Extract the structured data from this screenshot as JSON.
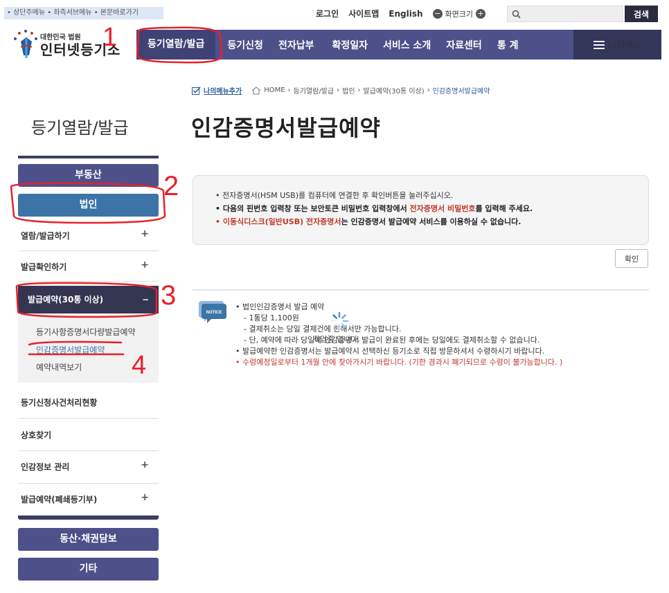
{
  "topbar": {
    "skip_links": "• 상단주메뉴 • 좌측서브메뉴 • 본문바로가기",
    "login": "로그인",
    "sitemap": "사이트맵",
    "english": "English",
    "zoom_label": "화면크기",
    "search_button": "검색"
  },
  "logo": {
    "small": "대한민국 법원",
    "big": "인터넷등기소"
  },
  "nav": {
    "items": [
      "등기열람/발급",
      "등기신청",
      "전자납부",
      "확정일자",
      "서비스 소개",
      "자료센터",
      "통 계"
    ],
    "mymenu": "나의메뉴"
  },
  "breadcrumb": {
    "add": "나의메뉴추가",
    "home": "HOME",
    "path": [
      "등기열람/발급",
      "법인",
      "발급예약(30통 이상)"
    ],
    "current": "인감증명서발급예약"
  },
  "side": {
    "title": "등기열람/발급",
    "cat_realty": "부동산",
    "cat_corp": "법인",
    "item_view": "열람/발급하기",
    "item_check": "발급확인하기",
    "item_reserve": "발급예약(30통 이상)",
    "sub_1": "등기사항증명서다량발급예약",
    "sub_2": "인감증명서발급예약",
    "sub_3": "예약내역보기",
    "item_status": "등기신청사건처리현황",
    "item_find": "상호찾기",
    "item_seal": "인감정보 관리",
    "item_closed": "발급예약(폐쇄등기부)",
    "cat_movable": "동산·채권담보",
    "cat_other": "기타"
  },
  "main": {
    "title": "인감증명서발급예약",
    "notice_1": "• 전자증명서(HSM USB)를 컴퓨터에 연결한 후 확인버튼을 눌러주십시오.",
    "notice_2_a": "• 다음의 핀번호 입력창 또는 보안토큰 비밀번호 입력창에서 ",
    "notice_2_b": "전자증명서 비밀번호",
    "notice_2_c": "를 입력해 주세요.",
    "notice_3_a": "• 이동식디스크(일반USB) 전자증명서",
    "notice_3_b": "는 인감증명서 발급예약 서비스를 이용하실 수 없습니다.",
    "confirm": "확인",
    "info_1": "• 법인인감증명서 발급 예약",
    "info_2": "- 1통당 1,100원",
    "info_3": "- 결제취소는 당일 결제건에 한해서만 가능합니다.",
    "info_4": "- 단, 예약에 따라 당일에 인감증명서 발급이 완료된 후에는 당일에도 결제취소할 수 없습니다.",
    "info_5": "• 발급예약한 인감증명서는 발급예약시 선택하신 등기소로 직접 방문하셔서 수령하시기 바랍니다.",
    "info_6": "• 수령예정일로부터 1개월 안에 찾아가시기 바랍니다. (기한 경과시 폐기되므로 수령이 불가능합니다. )",
    "loading": "작업중 입니다.",
    "notice_icon_label": "NOTICE"
  },
  "annotations": [
    "1",
    "2",
    "3",
    "4"
  ],
  "colors": {
    "nav": "#4d5089",
    "corp": "#3d74a8",
    "red": "#c0392b",
    "annotation": "#e8202a"
  }
}
